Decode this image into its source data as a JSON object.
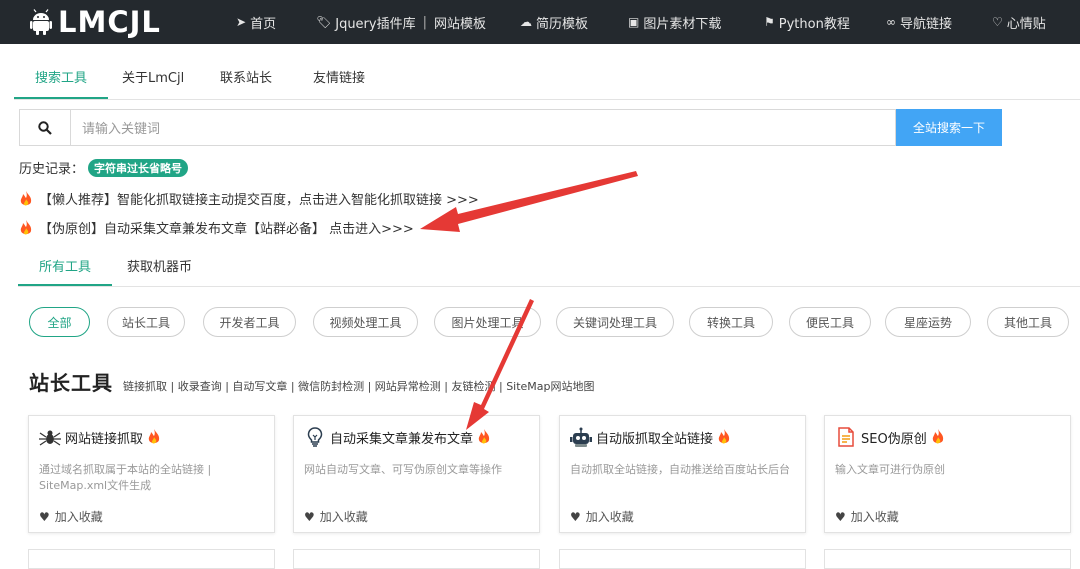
{
  "header": {
    "logo_text": "LMCJL",
    "nav": [
      {
        "icon": "paper-plane-icon",
        "label": "首页"
      },
      {
        "icon": "tag-icon",
        "label": "Jquery插件库",
        "extra": "网站模板"
      },
      {
        "icon": "cloud-download-icon",
        "label": "简历模板"
      },
      {
        "icon": "image-icon",
        "label": "图片素材下载"
      },
      {
        "icon": "signpost-icon",
        "label": "Python教程"
      },
      {
        "icon": "link-icon",
        "label": "导航链接"
      },
      {
        "icon": "heart-icon",
        "label": "心情贴"
      }
    ]
  },
  "top_tabs": [
    "搜索工具",
    "关于LmCjl",
    "联系站长",
    "友情链接"
  ],
  "search": {
    "placeholder": "请输入关键词",
    "button": "全站搜索一下"
  },
  "history": {
    "label": "历史记录：",
    "badge": "字符串过长省略号"
  },
  "notices": [
    "【懒人推荐】智能化抓取链接主动提交百度，点击进入智能化抓取链接 >>>",
    "【伪原创】自动采集文章兼发布文章【站群必备】 点击进入>>>"
  ],
  "tool_tabs": [
    "所有工具",
    "获取机器币"
  ],
  "categories": [
    "全部",
    "站长工具",
    "开发者工具",
    "视频处理工具",
    "图片处理工具",
    "关键词处理工具",
    "转换工具",
    "便民工具",
    "星座运势",
    "其他工具"
  ],
  "section": {
    "title": "站长工具",
    "links": "链接抓取 | 收录查询 | 自动写文章 | 微信防封检测 | 网站异常检测 | 友链检测 | SiteMap网站地图"
  },
  "cards": [
    {
      "icon": "spider-icon",
      "title": "网站链接抓取",
      "desc": "通过域名抓取属于本站的全站链接 | SiteMap.xml文件生成",
      "fav": "加入收藏"
    },
    {
      "icon": "lightbulb-icon",
      "title": "自动采集文章兼发布文章",
      "desc": "网站自动写文章、可写伪原创文章等操作",
      "fav": "加入收藏"
    },
    {
      "icon": "robot-icon",
      "title": "自动版抓取全站链接",
      "desc": "自动抓取全站链接，自动推送给百度站长后台",
      "fav": "加入收藏"
    },
    {
      "icon": "document-icon",
      "title": "SEO伪原创",
      "desc": "输入文章可进行伪原创",
      "fav": "加入收藏"
    }
  ],
  "colors": {
    "topbar": "#24292e",
    "accent": "#21a586",
    "search_button": "#42a5f5",
    "arrow": "#e53935"
  }
}
